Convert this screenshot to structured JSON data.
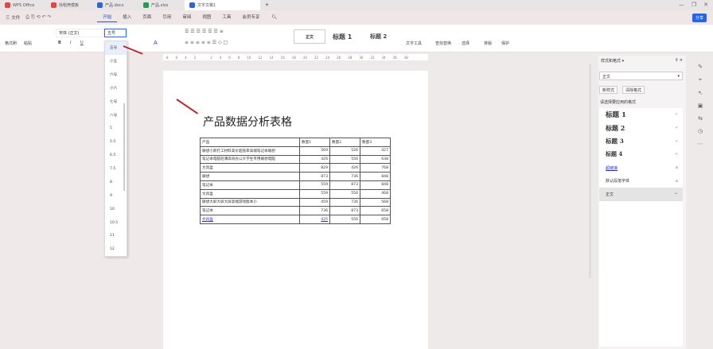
{
  "window_tabs": [
    {
      "label": "WPS Office",
      "color": "#e04848"
    },
    {
      "label": "找稻壳模板",
      "color": "#e04848"
    },
    {
      "label": "产品.docx",
      "color": "#2f63d8"
    },
    {
      "label": "产品.xlsx",
      "color": "#1f9d55"
    },
    {
      "label": "文字文稿1",
      "color": "#2f63d8"
    }
  ],
  "menu": {
    "file": "三 文件",
    "tabs": [
      "开始",
      "插入",
      "页面",
      "引用",
      "审阅",
      "视图",
      "工具",
      "会员专享"
    ],
    "active": "开始",
    "share": "分享"
  },
  "ribbon": {
    "format_painter": "格式刷",
    "paste": "粘贴",
    "font_name": "宋体 (正文)",
    "font_size": "五号",
    "bold": "B",
    "italic": "I",
    "underline": "U",
    "styles": [
      "正文",
      "标题 1",
      "标题 2"
    ],
    "text_tools": "文字工具",
    "find_replace": "查找替换",
    "select": "选择",
    "layout": "排版",
    "protect": "保护"
  },
  "font_size_options": [
    "五号",
    "小五",
    "六号",
    "小六",
    "七号",
    "八号",
    "5",
    "5.5",
    "6.5",
    "7.5",
    "8",
    "9",
    "10",
    "10.5",
    "11",
    "12"
  ],
  "ruler": [
    "8",
    "6",
    "4",
    "2",
    "",
    "2",
    "4",
    "6",
    "8",
    "10",
    "12",
    "14",
    "16",
    "18",
    "20",
    "22",
    "24",
    "26",
    "28",
    "30",
    "32",
    "34",
    "36",
    "38"
  ],
  "document": {
    "title": "产品数据分析表格",
    "table": {
      "headers": [
        "产品",
        "数量1",
        "数量2",
        "数量3"
      ],
      "rows": [
        [
          "联想小新打工材料高价超低率高端笔记本联想",
          "569",
          "526",
          "427"
        ],
        [
          "笔记本电脑轻薄高效办公大学生专用联想电脑",
          "426",
          "556",
          "638"
        ],
        [
          "文具盒",
          "829",
          "426",
          "768"
        ],
        [
          "联想",
          "873",
          "736",
          "848"
        ],
        [
          "笔记本",
          "559",
          "873",
          "848"
        ],
        [
          "文具盒",
          "559",
          "556",
          "468"
        ],
        [
          "联想大屏大屏大屏高端游戏版本小",
          "459",
          "736",
          "568"
        ],
        [
          "笔记本",
          "736",
          "873",
          "658"
        ],
        [
          "文具盒",
          "425",
          "556",
          "658"
        ]
      ]
    }
  },
  "panel": {
    "title": "样式和格式 ▾",
    "current": "正文",
    "new_style": "新样式",
    "clear_format": "清除格式",
    "apply_label": "请选择要应用的格式",
    "items": [
      {
        "label": "标题 1",
        "mark": "↵"
      },
      {
        "label": "标题 2",
        "mark": "↵"
      },
      {
        "label": "标题 3",
        "mark": "↵"
      },
      {
        "label": "标题 4",
        "mark": "↵"
      },
      {
        "label": "超链接",
        "mark": "a"
      },
      {
        "label": "默认段落字体",
        "mark": "a"
      },
      {
        "label": "正文",
        "mark": "↵"
      }
    ]
  }
}
